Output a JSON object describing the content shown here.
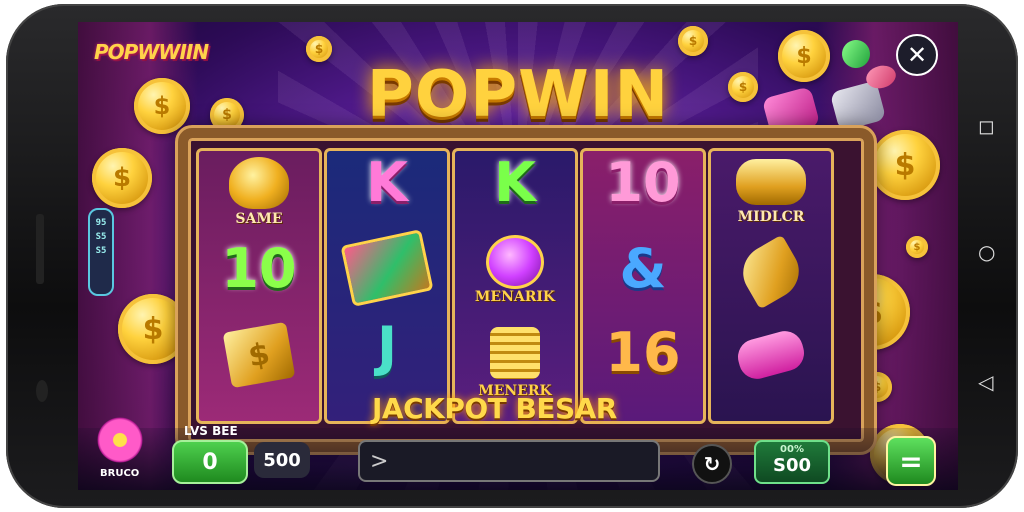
{
  "game": {
    "logo_small": "POPWWIIN",
    "title": "POPWIN",
    "close_label": "✕",
    "side_panel_text": [
      "95",
      "S5",
      "S5"
    ],
    "jackpot": "JACKPOT BESAR",
    "reels": [
      {
        "top": "SAME",
        "mid": "10"
      },
      {
        "top": "K",
        "bottom": "J"
      },
      {
        "top": "K",
        "mid": "MENARIK"
      },
      {
        "top": "10",
        "mid": "&",
        "bottom": "16"
      },
      {
        "top": "MIDLCR"
      }
    ],
    "reel3_bottom_label": "MENERK"
  },
  "controls": {
    "bet_label": "LVS BEE",
    "bet_value": "0",
    "bet_amount": "500",
    "input_placeholder": ">",
    "refresh_label": "↻",
    "win_label": "00%",
    "win_value": "S00",
    "menu_label": "=",
    "flower_label": "BRUCO"
  },
  "phone_nav": {
    "back": "◻",
    "home": "○",
    "recent": "◁"
  },
  "colors": {
    "title_gold": "#ffd23e",
    "bg_purple": "#5a1e9a",
    "bet_green": "#4ed04e"
  }
}
